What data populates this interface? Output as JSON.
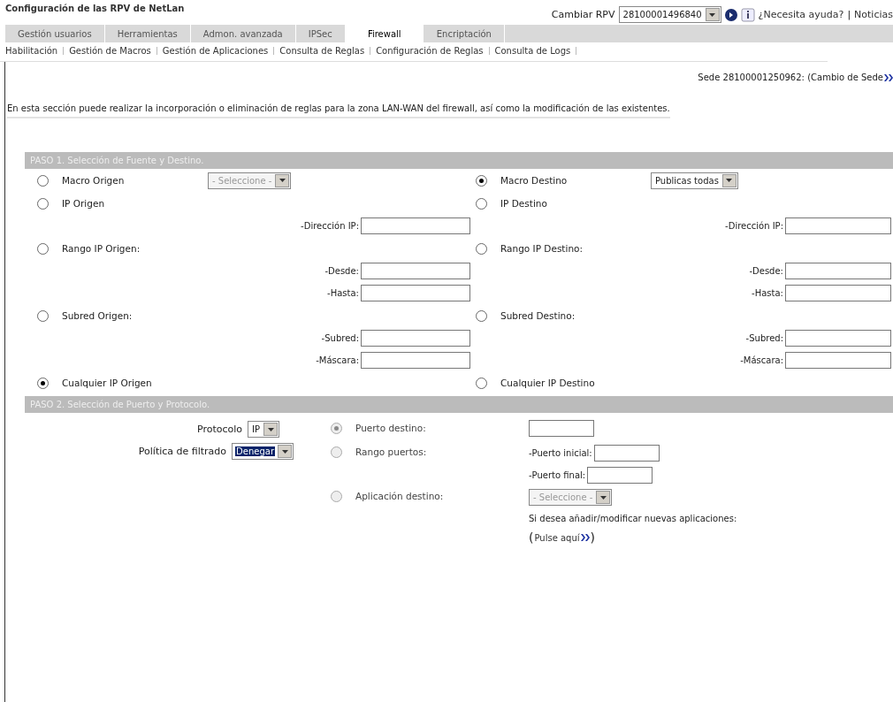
{
  "header": {
    "title": "Configuración de las RPV de NetLan",
    "rpv_label": "Cambiar RPV",
    "rpv_value": "28100001496840",
    "links": [
      "¿Necesita ayuda?",
      "Noticias"
    ],
    "separator": "|"
  },
  "tabs": [
    {
      "label": "Gestión usuarios",
      "selected": false
    },
    {
      "label": "Herramientas",
      "selected": false
    },
    {
      "label": "Admon. avanzada",
      "selected": false
    },
    {
      "label": "IPSec",
      "selected": false
    },
    {
      "label": "Firewall",
      "selected": true
    },
    {
      "label": "Encriptación",
      "selected": false
    }
  ],
  "subnav": [
    "Habilitación",
    "Gestión de Macros",
    "Gestión de Aplicaciones",
    "Consulta de Reglas",
    "Configuración de Reglas",
    "Consulta de Logs"
  ],
  "sede": "Sede 28100001250962: (Cambio de Sede",
  "intro": "En esta sección puede realizar la incorporación o eliminación de reglas para la zona LAN-WAN del firewall, así como la modificación de las existentes.",
  "step1": {
    "title": "PASO 1. Selección de Fuente y Destino.",
    "origin": [
      {
        "kind": "select",
        "label": "Macro Origen",
        "selected": false,
        "value": "- Seleccione -",
        "disabled": true
      },
      {
        "kind": "fields",
        "label": "IP Origen",
        "selected": false,
        "fields": [
          "-Dirección IP:"
        ]
      },
      {
        "kind": "fields",
        "label": "Rango IP Origen:",
        "selected": false,
        "fields": [
          "-Desde:",
          "-Hasta:"
        ]
      },
      {
        "kind": "fields",
        "label": "Subred Origen:",
        "selected": false,
        "fields": [
          "-Subred:",
          "-Máscara:"
        ]
      },
      {
        "kind": "plain",
        "label": "Cualquier IP Origen",
        "selected": true
      }
    ],
    "destination": [
      {
        "kind": "select",
        "label": "Macro Destino",
        "selected": true,
        "value": "Publicas todas",
        "disabled": false
      },
      {
        "kind": "fields",
        "label": "IP Destino",
        "selected": false,
        "fields": [
          "-Dirección IP:"
        ]
      },
      {
        "kind": "fields",
        "label": "Rango IP Destino:",
        "selected": false,
        "fields": [
          "-Desde:",
          "-Hasta:"
        ]
      },
      {
        "kind": "fields",
        "label": "Subred Destino:",
        "selected": false,
        "fields": [
          "-Subred:",
          "-Máscara:"
        ]
      },
      {
        "kind": "plain",
        "label": "Cualquier IP Destino",
        "selected": false
      }
    ]
  },
  "step2": {
    "title": "PASO 2. Selección de Puerto y Protocolo.",
    "settings": [
      {
        "label": "Protocolo",
        "value": "IP",
        "highlighted": false
      },
      {
        "label": "Política de filtrado",
        "value": "Denegar",
        "highlighted": true
      }
    ],
    "ports": [
      {
        "kind": "input",
        "label": "Puerto destino:",
        "selected": true,
        "disabled": true
      },
      {
        "kind": "fields",
        "label": "Rango puertos:",
        "selected": false,
        "disabled": true,
        "fields": [
          "-Puerto inicial:",
          "-Puerto final:"
        ]
      },
      {
        "kind": "select",
        "label": "Aplicación destino:",
        "selected": false,
        "disabled": true,
        "value": "- Seleccione -",
        "note": "Si desea añadir/modificar nuevas aplicaciones:",
        "link_open": "(",
        "link": "Pulse aquí",
        "link_close": ")"
      }
    ]
  }
}
